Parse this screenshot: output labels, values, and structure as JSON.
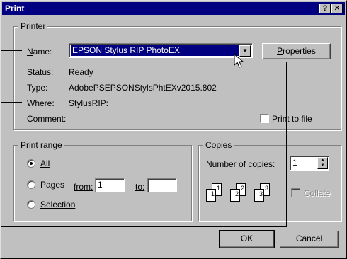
{
  "window": {
    "title": "Print",
    "help_label": "?",
    "close_label": "✕"
  },
  "printer": {
    "group_label": "Printer",
    "name_label": "Name:",
    "name_value": "EPSON Stylus RIP PhotoEX",
    "properties_label": "Properties",
    "status_label": "Status:",
    "status_value": "Ready",
    "type_label": "Type:",
    "type_value": "AdobePSEPSONStylsPhtEXv2015.802",
    "where_label": "Where:",
    "where_value": "StylusRIP:",
    "comment_label": "Comment:",
    "comment_value": "",
    "print_to_file_label": "Print to file",
    "print_to_file_checked": false
  },
  "print_range": {
    "group_label": "Print range",
    "all_label": "All",
    "pages_label": "Pages",
    "from_label": "from:",
    "from_value": "1",
    "to_label": "to:",
    "to_value": "",
    "selection_label": "Selection",
    "selected": "all"
  },
  "copies": {
    "group_label": "Copies",
    "number_label": "Number of copies:",
    "number_value": "1",
    "collate_label": "Collate",
    "collate_checked": false,
    "collate_enabled": false,
    "page_icon_numbers": [
      "1",
      "1",
      "2",
      "2",
      "3",
      "3"
    ]
  },
  "buttons": {
    "ok_label": "OK",
    "cancel_label": "Cancel"
  }
}
